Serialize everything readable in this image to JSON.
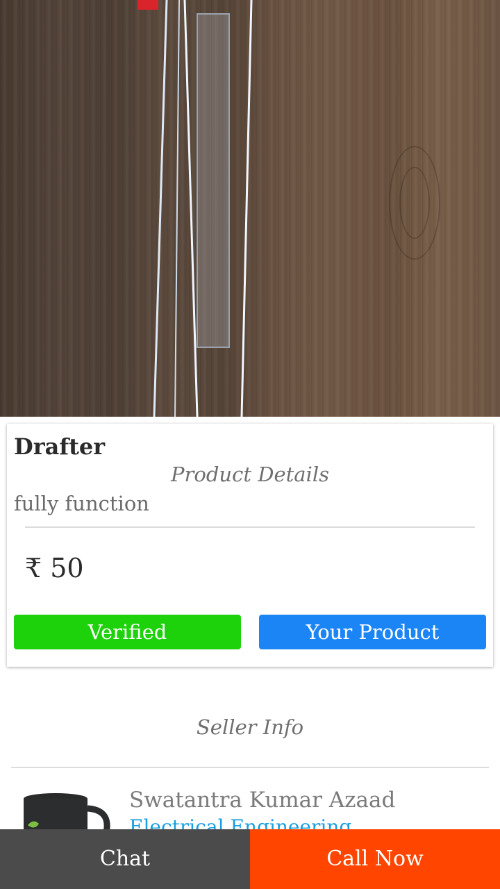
{
  "product": {
    "title": "Drafter",
    "details_heading": "Product Details",
    "description": "fully function",
    "price": "₹ 50",
    "verified_label": "Verified",
    "your_product_label": "Your Product"
  },
  "seller": {
    "heading": "Seller Info",
    "name": "Swatantra Kumar Azaad",
    "department": "Electrical Engineering"
  },
  "actions": {
    "chat_label": "Chat",
    "call_label": "Call Now"
  },
  "colors": {
    "verified": "#1ed20b",
    "your_product": "#1b85f6",
    "chat": "#4b4b4b",
    "call": "#ff4500",
    "link": "#1a9fe0"
  }
}
